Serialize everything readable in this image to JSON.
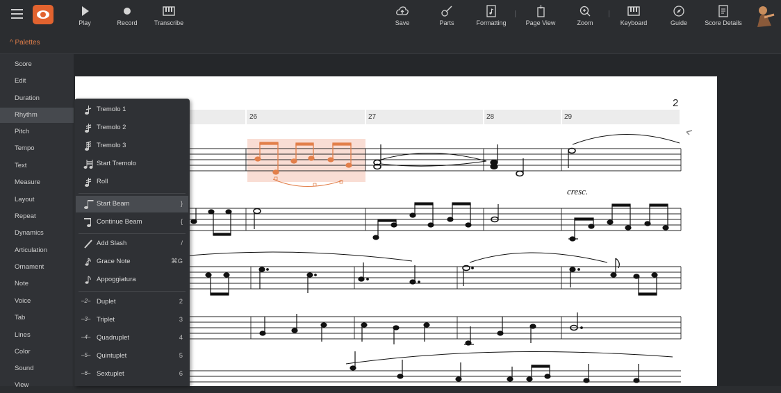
{
  "toolbar": {
    "left": [
      "Play",
      "Record",
      "Transcribe"
    ],
    "right": [
      "Save",
      "Parts",
      "Formatting",
      "Page View",
      "Zoom",
      "Keyboard",
      "Guide",
      "Score Details"
    ]
  },
  "palettes_header": "^ Palettes",
  "palettes": [
    "Score",
    "Edit",
    "Duration",
    "Rhythm",
    "Pitch",
    "Tempo",
    "Text",
    "Measure",
    "Layout",
    "Repeat",
    "Dynamics",
    "Articulation",
    "Ornament",
    "Note",
    "Voice",
    "Tab",
    "Lines",
    "Color",
    "Sound",
    "View"
  ],
  "active_palette": "Rhythm",
  "rhythm_menu": [
    {
      "label": "Tremolo 1",
      "shortcut": ""
    },
    {
      "label": "Tremolo 2",
      "shortcut": ""
    },
    {
      "label": "Tremolo 3",
      "shortcut": ""
    },
    {
      "label": "Start Tremolo",
      "shortcut": ""
    },
    {
      "label": "Roll",
      "shortcut": ""
    },
    {
      "label": "Start Beam",
      "shortcut": "}"
    },
    {
      "label": "Continue Beam",
      "shortcut": "{"
    },
    {
      "label": "Add Slash",
      "shortcut": "/"
    },
    {
      "label": "Grace Note",
      "shortcut": "⌘G"
    },
    {
      "label": "Appoggiatura",
      "shortcut": ""
    },
    {
      "label": "Duplet",
      "shortcut": "2"
    },
    {
      "label": "Triplet",
      "shortcut": "3"
    },
    {
      "label": "Quadruplet",
      "shortcut": "4"
    },
    {
      "label": "Quintuplet",
      "shortcut": "5"
    },
    {
      "label": "Sextuplet",
      "shortcut": "6"
    }
  ],
  "tuplet_icons": [
    "2",
    "3",
    "4",
    "5",
    "6"
  ],
  "score": {
    "page_number": "2",
    "measures": [
      "26",
      "27",
      "28",
      "29"
    ],
    "expression": "cresc."
  },
  "colors": {
    "accent": "#e27f4a",
    "selection": "#f8d7cc"
  }
}
